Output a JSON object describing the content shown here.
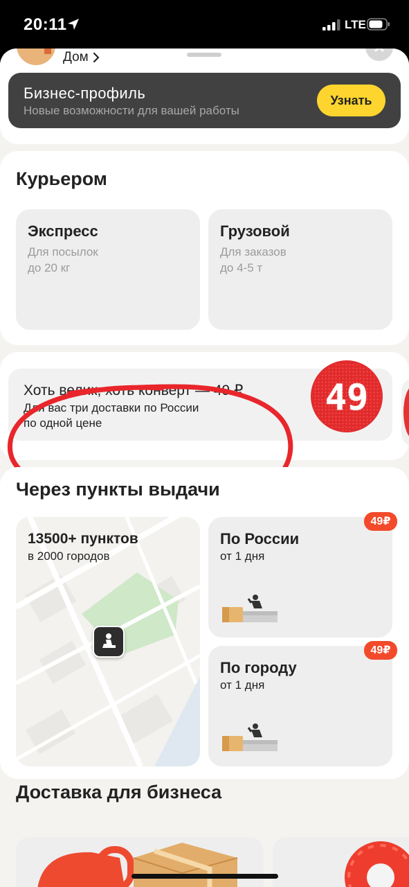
{
  "status_bar": {
    "time": "20:11",
    "network": "LTE"
  },
  "header": {
    "address_label": "Дом"
  },
  "business_banner": {
    "title": "Бизнес-профиль",
    "subtitle": "Новые возможности для вашей работы",
    "button_label": "Узнать"
  },
  "courier": {
    "title": "Курьером",
    "tiles": [
      {
        "title": "Экспресс",
        "subtitle": "Для посылок\nдо 20 кг"
      },
      {
        "title": "Грузовой",
        "subtitle": "Для заказов\nдо 4-5 т"
      }
    ]
  },
  "promo": {
    "title": "Хоть велик, хоть конверт — 49 ₽",
    "subtitle": "Для вас три доставки по России\nпо одной цене",
    "badge_text": "49",
    "annotation_color": "#e8262b"
  },
  "pickup": {
    "title": "Через пункты выдачи",
    "map_tile": {
      "title": "13500+ пунктов",
      "subtitle": "в 2000 городов"
    },
    "tiles": [
      {
        "title": "По России",
        "subtitle": "от 1 дня",
        "price": "49₽"
      },
      {
        "title": "По городу",
        "subtitle": "от 1 дня",
        "price": "49₽"
      }
    ]
  },
  "business_delivery": {
    "title": "Доставка для бизнеса"
  },
  "colors": {
    "accent_yellow": "#fed52e",
    "price_red": "#f24a2a",
    "banner_dark": "#414141"
  }
}
